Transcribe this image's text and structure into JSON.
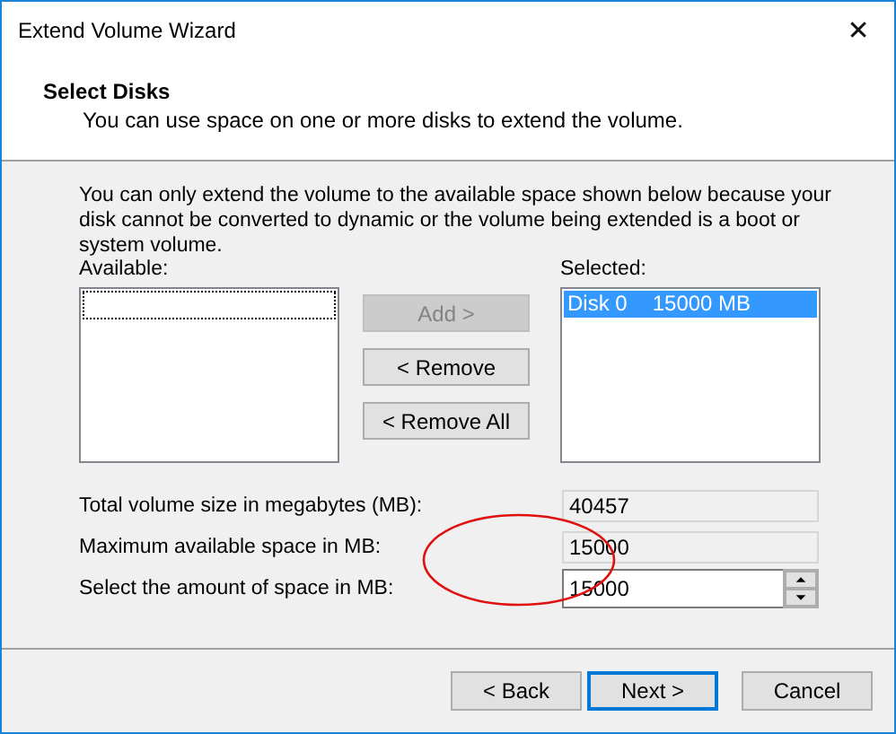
{
  "window": {
    "title": "Extend Volume Wizard",
    "close_glyph": "✕"
  },
  "header": {
    "title": "Select Disks",
    "subtitle": "You can use space on one or more disks to extend the volume."
  },
  "description": "You can only extend the volume to the available space shown below because your disk cannot be converted to dynamic or the volume being extended is a boot or system volume.",
  "available": {
    "label": "Available:",
    "focus_outline": true
  },
  "transfer_buttons": [
    {
      "label": "Add >",
      "disabled": true
    },
    {
      "label": "< Remove",
      "disabled": false
    },
    {
      "label": "< Remove All",
      "disabled": false
    }
  ],
  "selected_list": {
    "label": "Selected:",
    "items": [
      {
        "disk": "Disk 0",
        "size": "15000 MB",
        "selected": true
      }
    ]
  },
  "fields": [
    {
      "label": "Total volume size in megabytes (MB):",
      "value": "40457",
      "kind": "readonly"
    },
    {
      "label": "Maximum available space in MB:",
      "value": "15000",
      "kind": "readonly"
    },
    {
      "label": "Select the amount of space in MB:",
      "value": "15000",
      "kind": "spinner"
    }
  ],
  "highlight": {
    "kind": "ellipse"
  },
  "footer_buttons": [
    {
      "label": "< Back",
      "default": false
    },
    {
      "label": "Next >",
      "default": true
    },
    {
      "label": "Cancel",
      "default": false
    }
  ]
}
